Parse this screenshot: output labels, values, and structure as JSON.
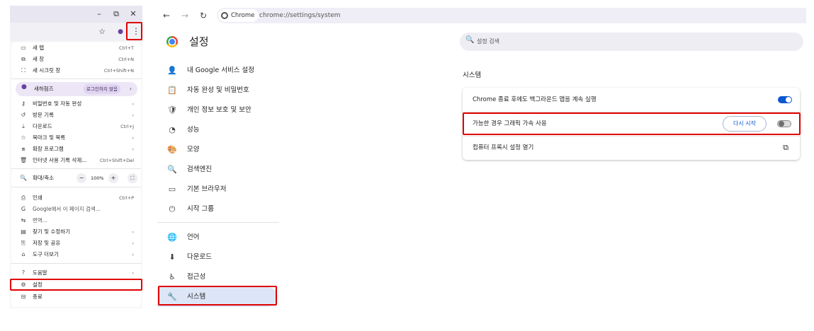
{
  "window": {
    "minimize_icon": "minimize-icon",
    "restore_icon": "restore-icon",
    "close_icon": "close-icon",
    "minimize_glyph": "–",
    "restore_glyph": "⧉",
    "close_glyph": "✕"
  },
  "menu": {
    "items_top": [
      {
        "icon": "new-tab-icon",
        "glyph": "▭",
        "label": "새 탭",
        "shortcut": "Ctrl+T"
      },
      {
        "icon": "new-window-icon",
        "glyph": "⧉",
        "label": "새 창",
        "shortcut": "Ctrl+N"
      },
      {
        "icon": "incognito-icon",
        "glyph": "⛶",
        "label": "새 시크릿 창",
        "shortcut": "Ctrl+Shift+N"
      }
    ],
    "profile": {
      "label": "새하험즈",
      "badge": "로그인하지 않음",
      "chevron": "›"
    },
    "items_mid": [
      {
        "icon": "key-icon",
        "glyph": "⚷",
        "label": "비밀번호 및 자동 완성",
        "shortcut": "›"
      },
      {
        "icon": "history-icon",
        "glyph": "↺",
        "label": "방문 기록",
        "shortcut": "›"
      },
      {
        "icon": "download-icon",
        "glyph": "⤓",
        "label": "다운로드",
        "shortcut": "Ctrl+J"
      },
      {
        "icon": "bookmark-star-icon",
        "glyph": "☆",
        "label": "북마크 및 목록",
        "shortcut": "›"
      },
      {
        "icon": "extension-icon",
        "glyph": "⧈",
        "label": "확장 프로그램",
        "shortcut": "›"
      },
      {
        "icon": "trash-icon",
        "glyph": "🗑",
        "label": "인터넷 사용 기록 삭제...",
        "shortcut": "Ctrl+Shift+Del"
      }
    ],
    "zoom": {
      "label": "확대/축소",
      "minus": "−",
      "value": "100%",
      "plus": "+",
      "fullscreen": "⛶"
    },
    "items_low": [
      {
        "icon": "print-icon",
        "glyph": "⎙",
        "label": "인쇄",
        "shortcut": "Ctrl+P"
      },
      {
        "icon": "google-g-icon",
        "glyph": "G",
        "label": "Google에서 이 페이지 검색...",
        "shortcut": ""
      },
      {
        "icon": "translate-icon",
        "glyph": "⇆",
        "label": "번역...",
        "shortcut": ""
      },
      {
        "icon": "find-edit-icon",
        "glyph": "▤",
        "label": "찾기 및 수정하기",
        "shortcut": "›"
      },
      {
        "icon": "save-share-icon",
        "glyph": "⎘",
        "label": "저장 및 공유",
        "shortcut": "›"
      },
      {
        "icon": "tools-icon",
        "glyph": "⌂",
        "label": "도구 더보기",
        "shortcut": "›"
      }
    ],
    "items_bottom": [
      {
        "icon": "help-icon",
        "glyph": "?",
        "label": "도움말",
        "shortcut": "›"
      },
      {
        "icon": "settings-gear-icon",
        "glyph": "⚙",
        "label": "설정",
        "shortcut": ""
      },
      {
        "icon": "exit-icon",
        "glyph": "⊟",
        "label": "종료",
        "shortcut": ""
      }
    ]
  },
  "toolbar": {
    "star_glyph": "☆",
    "profile_glyph": "●",
    "kebab_glyph": "⋮"
  },
  "nav": {
    "back": "←",
    "forward": "→",
    "reload": "↻",
    "chip": "Chrome",
    "url": "chrome://settings/system"
  },
  "settings": {
    "title": "설정",
    "search_placeholder": "설정 검색",
    "sidebar": [
      {
        "icon": "person-icon",
        "glyph": "👤",
        "label": "내 Google 서비스 설정"
      },
      {
        "icon": "clipboard-icon",
        "glyph": "📋",
        "label": "자동 완성 및 비밀번호"
      },
      {
        "icon": "shield-icon",
        "glyph": "🛡",
        "label": "개인 정보 보호 및 보안"
      },
      {
        "icon": "speedometer-icon",
        "glyph": "◔",
        "label": "성능"
      },
      {
        "icon": "palette-icon",
        "glyph": "🎨",
        "label": "모양"
      },
      {
        "icon": "search-icon",
        "glyph": "🔍",
        "label": "검색엔진"
      },
      {
        "icon": "browser-icon",
        "glyph": "▭",
        "label": "기본 브라우저"
      },
      {
        "icon": "power-icon",
        "glyph": "⏻",
        "label": "시작 그룹"
      },
      {
        "icon": "globe-icon",
        "glyph": "🌐",
        "label": "언어"
      },
      {
        "icon": "download-icon",
        "glyph": "⬇",
        "label": "다운로드"
      },
      {
        "icon": "accessibility-icon",
        "glyph": "♿",
        "label": "접근성"
      },
      {
        "icon": "wrench-icon",
        "glyph": "🔧",
        "label": "시스템"
      }
    ],
    "section_title": "시스템",
    "rows": {
      "background": {
        "label": "Chrome 종료 후에도 백그라운드 앱을 계속 실행",
        "enabled": true
      },
      "gpu": {
        "label": "가능한 경우 그래픽 가속 사용",
        "restart": "다시 시작",
        "enabled": false
      },
      "proxy": {
        "label": "컴퓨터 프록시 설정 열기",
        "icon": "external-link-icon",
        "glyph": "⧉"
      }
    },
    "accent_color": "#0b57d0",
    "highlight_color": "#e00000"
  }
}
